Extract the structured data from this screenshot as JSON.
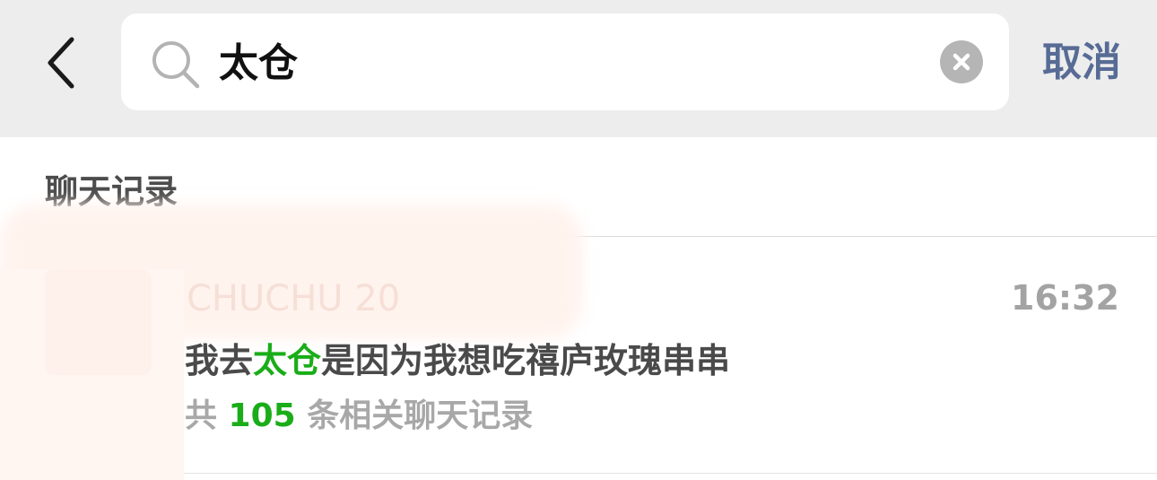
{
  "search": {
    "query": "太仓",
    "cancel_label": "取消"
  },
  "section": {
    "title": "聊天记录"
  },
  "result": {
    "contact_name": "CHUCHU 20",
    "time": "16:32",
    "message_before": "我去",
    "message_highlight": "太仓",
    "message_after": "是因为我想吃禧庐玫瑰串串",
    "count_prefix": "共 ",
    "count_value": "105",
    "count_suffix": " 条相关聊天记录"
  },
  "colors": {
    "accent": "#1aad19",
    "link": "#576b95",
    "topbar_bg": "#ededed",
    "muted": "#a8a8a8"
  },
  "icons": {
    "back": "chevron-left-icon",
    "search": "search-icon",
    "clear": "clear-icon"
  }
}
